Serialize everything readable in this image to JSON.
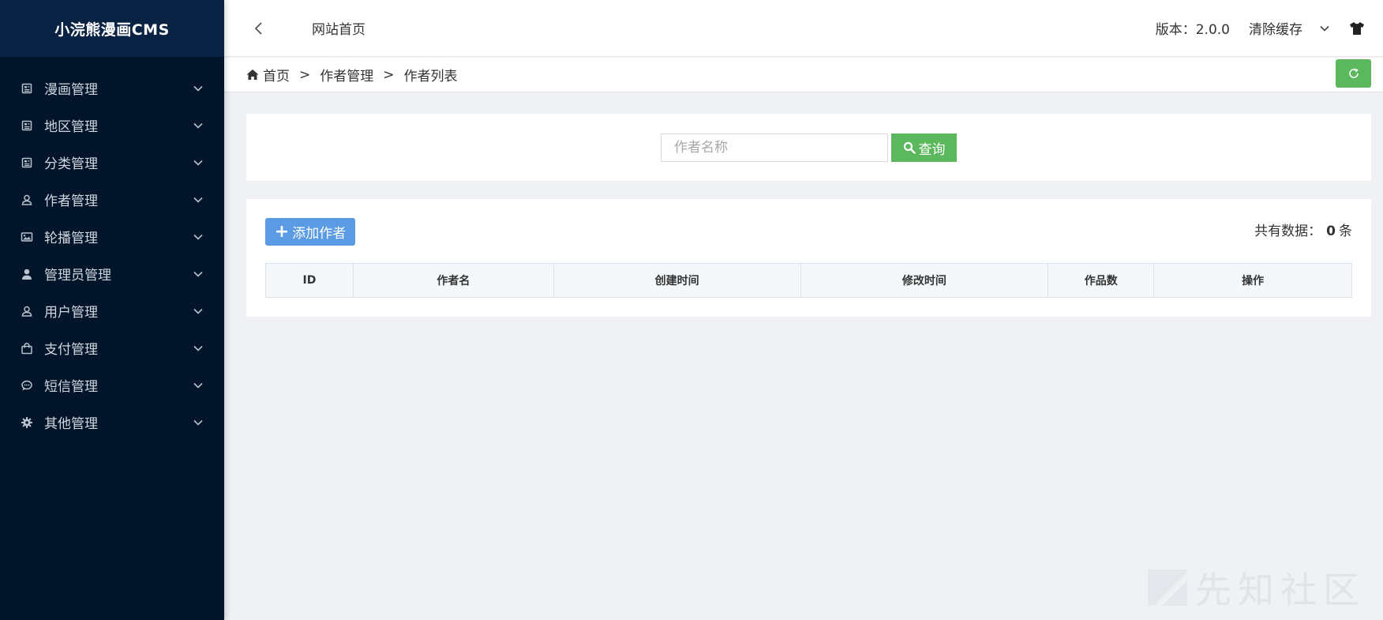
{
  "app": {
    "title": "小浣熊漫画CMS"
  },
  "sidebar": {
    "items": [
      {
        "label": "漫画管理",
        "icon": "newspaper-icon"
      },
      {
        "label": "地区管理",
        "icon": "newspaper-icon"
      },
      {
        "label": "分类管理",
        "icon": "newspaper-icon"
      },
      {
        "label": "作者管理",
        "icon": "user-outline-icon"
      },
      {
        "label": "轮播管理",
        "icon": "image-icon"
      },
      {
        "label": "管理员管理",
        "icon": "user-solid-icon"
      },
      {
        "label": "用户管理",
        "icon": "user-outline-icon"
      },
      {
        "label": "支付管理",
        "icon": "shopping-bag-icon"
      },
      {
        "label": "短信管理",
        "icon": "comment-icon"
      },
      {
        "label": "其他管理",
        "icon": "gear-icon"
      }
    ]
  },
  "header": {
    "title": "网站首页",
    "version": "版本：2.0.0",
    "clear_cache": "清除缓存"
  },
  "breadcrumb": {
    "items": [
      "首页",
      "作者管理",
      "作者列表"
    ],
    "separator": ">"
  },
  "search": {
    "placeholder": "作者名称",
    "value": "",
    "button_label": "查询"
  },
  "list": {
    "add_label": "添加作者",
    "count_prefix": "共有数据：",
    "count_value": "0",
    "count_suffix": "条",
    "columns": [
      "ID",
      "作者名",
      "创建时间",
      "修改时间",
      "作品数",
      "操作"
    ]
  },
  "watermark": {
    "text": "先知社区"
  },
  "colors": {
    "sidebar_bg": "#03152b",
    "logo_bg": "#072242",
    "success_green": "#5cb85c",
    "primary_blue": "#5a9be3",
    "page_bg": "#eff1f5"
  }
}
